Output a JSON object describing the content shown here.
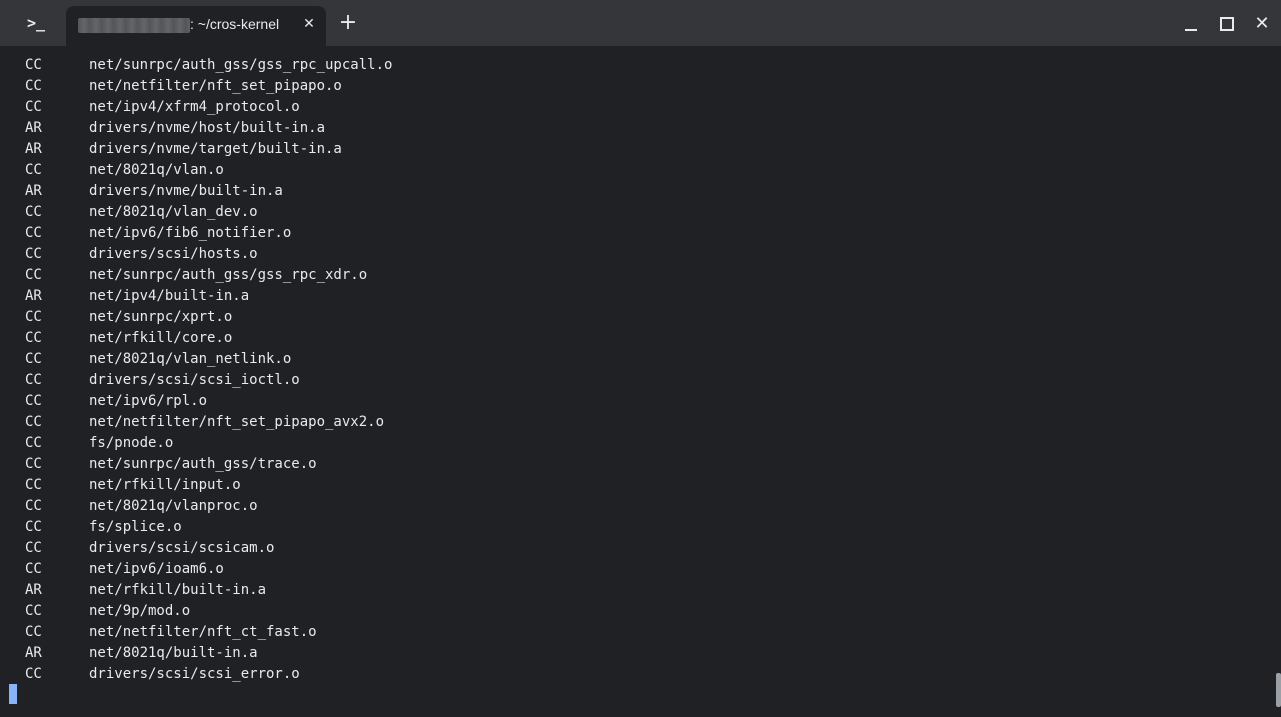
{
  "titlebar": {
    "app_icon": ">_",
    "tab_title": ": ~/cros-kernel",
    "tab_close": "✕",
    "new_tab": "+",
    "minimize_icon": "minimize-icon",
    "maximize_icon": "maximize-icon",
    "close": "✕"
  },
  "terminal": {
    "lines": [
      {
        "cmd": "CC",
        "path": "net/sunrpc/auth_gss/gss_rpc_upcall.o"
      },
      {
        "cmd": "CC",
        "path": "net/netfilter/nft_set_pipapo.o"
      },
      {
        "cmd": "CC",
        "path": "net/ipv4/xfrm4_protocol.o"
      },
      {
        "cmd": "AR",
        "path": "drivers/nvme/host/built-in.a"
      },
      {
        "cmd": "AR",
        "path": "drivers/nvme/target/built-in.a"
      },
      {
        "cmd": "CC",
        "path": "net/8021q/vlan.o"
      },
      {
        "cmd": "AR",
        "path": "drivers/nvme/built-in.a"
      },
      {
        "cmd": "CC",
        "path": "net/8021q/vlan_dev.o"
      },
      {
        "cmd": "CC",
        "path": "net/ipv6/fib6_notifier.o"
      },
      {
        "cmd": "CC",
        "path": "drivers/scsi/hosts.o"
      },
      {
        "cmd": "CC",
        "path": "net/sunrpc/auth_gss/gss_rpc_xdr.o"
      },
      {
        "cmd": "AR",
        "path": "net/ipv4/built-in.a"
      },
      {
        "cmd": "CC",
        "path": "net/sunrpc/xprt.o"
      },
      {
        "cmd": "CC",
        "path": "net/rfkill/core.o"
      },
      {
        "cmd": "CC",
        "path": "net/8021q/vlan_netlink.o"
      },
      {
        "cmd": "CC",
        "path": "drivers/scsi/scsi_ioctl.o"
      },
      {
        "cmd": "CC",
        "path": "net/ipv6/rpl.o"
      },
      {
        "cmd": "CC",
        "path": "net/netfilter/nft_set_pipapo_avx2.o"
      },
      {
        "cmd": "CC",
        "path": "fs/pnode.o"
      },
      {
        "cmd": "CC",
        "path": "net/sunrpc/auth_gss/trace.o"
      },
      {
        "cmd": "CC",
        "path": "net/rfkill/input.o"
      },
      {
        "cmd": "CC",
        "path": "net/8021q/vlanproc.o"
      },
      {
        "cmd": "CC",
        "path": "fs/splice.o"
      },
      {
        "cmd": "CC",
        "path": "drivers/scsi/scsicam.o"
      },
      {
        "cmd": "CC",
        "path": "net/ipv6/ioam6.o"
      },
      {
        "cmd": "AR",
        "path": "net/rfkill/built-in.a"
      },
      {
        "cmd": "CC",
        "path": "net/9p/mod.o"
      },
      {
        "cmd": "CC",
        "path": "net/netfilter/nft_ct_fast.o"
      },
      {
        "cmd": "AR",
        "path": "net/8021q/built-in.a"
      },
      {
        "cmd": "CC",
        "path": "drivers/scsi/scsi_error.o"
      }
    ]
  },
  "colors": {
    "titlebar_bg": "#35363a",
    "terminal_bg": "#202124",
    "text": "#e8eaed",
    "cursor": "#8ab4f8"
  }
}
